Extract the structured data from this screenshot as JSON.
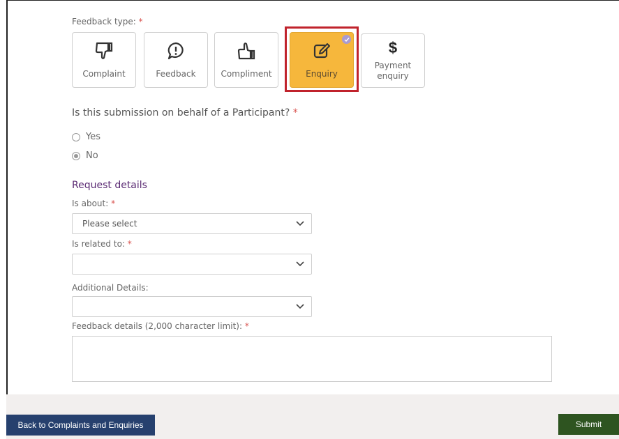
{
  "form": {
    "feedback_type_label": "Feedback type:",
    "required_mark": "*",
    "tiles": [
      {
        "label": "Complaint",
        "icon": "thumbs-down-icon"
      },
      {
        "label": "Feedback",
        "icon": "speech-bubble-exclamation-icon"
      },
      {
        "label": "Compliment",
        "icon": "thumbs-up-icon"
      },
      {
        "label": "Enquiry",
        "icon": "edit-pencil-icon",
        "selected": true
      },
      {
        "label_line1": "Payment",
        "label_line2": "enquiry",
        "icon": "dollar-icon"
      }
    ],
    "question": "Is this submission on behalf of a Participant?",
    "radio_yes": "Yes",
    "radio_no": "No",
    "radio_selected": "No",
    "section_title": "Request details",
    "is_about_label": "Is about:",
    "is_about_value": "Please select",
    "is_related_label": "Is related to:",
    "is_related_value": "",
    "additional_label": "Additional Details:",
    "additional_value": "",
    "details_label": "Feedback details (2,000 character limit):",
    "details_value": ""
  },
  "footer": {
    "back_label": "Back to Complaints and Enquiries",
    "submit_label": "Submit"
  },
  "colors": {
    "selected_tile": "#f6b73c",
    "highlight_outline": "#c0232c",
    "section_title": "#5a2a73",
    "back_button": "#26406e",
    "submit_button": "#2e5420",
    "required": "#d9534f"
  }
}
